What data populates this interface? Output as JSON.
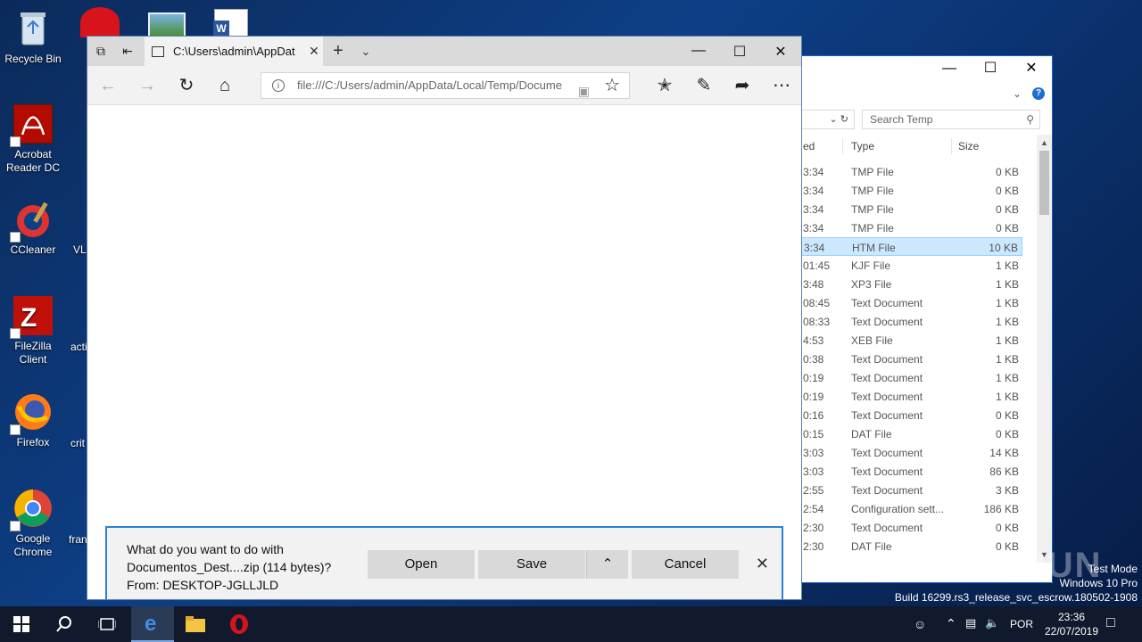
{
  "desktop": {
    "icons": [
      {
        "label": "Recycle Bin",
        "icon": "recycle-bin-icon"
      },
      {
        "label": "Acrobat Reader DC",
        "icon": "acrobat-icon"
      },
      {
        "label": "CCleaner",
        "icon": "ccleaner-icon"
      },
      {
        "label": "FileZilla Client",
        "icon": "filezilla-icon"
      },
      {
        "label": "Firefox",
        "icon": "firefox-icon"
      },
      {
        "label": "Google Chrome",
        "icon": "chrome-icon"
      }
    ],
    "partial_labels": [
      "VL",
      "acti",
      "crit",
      "fran"
    ]
  },
  "edge": {
    "tab_title": "C:\\Users\\admin\\AppDat",
    "url": "file:///C:/Users/admin/AppData/Local/Temp/Docume",
    "download": {
      "line1": "What do you want to do with",
      "line2": "Documentos_Dest....zip (114 bytes)?",
      "line3": "From: DESKTOP-JGLLJLD",
      "open": "Open",
      "save": "Save",
      "cancel": "Cancel"
    }
  },
  "explorer": {
    "search_placeholder": "Search Temp",
    "col_modified": "ed",
    "col_type": "Type",
    "col_size": "Size",
    "rows": [
      {
        "time": "3:34",
        "type": "TMP File",
        "size": "0 KB"
      },
      {
        "time": "3:34",
        "type": "TMP File",
        "size": "0 KB"
      },
      {
        "time": "3:34",
        "type": "TMP File",
        "size": "0 KB"
      },
      {
        "time": "3:34",
        "type": "TMP File",
        "size": "0 KB"
      },
      {
        "time": "3:34",
        "type": "HTM File",
        "size": "10 KB",
        "selected": true
      },
      {
        "time": "01:45",
        "type": "KJF File",
        "size": "1 KB"
      },
      {
        "time": "3:48",
        "type": "XP3 File",
        "size": "1 KB"
      },
      {
        "time": "08:45",
        "type": "Text Document",
        "size": "1 KB"
      },
      {
        "time": "08:33",
        "type": "Text Document",
        "size": "1 KB"
      },
      {
        "time": "4:53",
        "type": "XEB File",
        "size": "1 KB"
      },
      {
        "time": "0:38",
        "type": "Text Document",
        "size": "1 KB"
      },
      {
        "time": "0:19",
        "type": "Text Document",
        "size": "1 KB"
      },
      {
        "time": "0:19",
        "type": "Text Document",
        "size": "1 KB"
      },
      {
        "time": "0:16",
        "type": "Text Document",
        "size": "0 KB"
      },
      {
        "time": "0:15",
        "type": "DAT File",
        "size": "0 KB"
      },
      {
        "time": "3:03",
        "type": "Text Document",
        "size": "14 KB"
      },
      {
        "time": "3:03",
        "type": "Text Document",
        "size": "86 KB"
      },
      {
        "time": "2:55",
        "type": "Text Document",
        "size": "3 KB"
      },
      {
        "time": "2:54",
        "type": "Configuration sett...",
        "size": "186 KB"
      },
      {
        "time": "2:30",
        "type": "Text Document",
        "size": "0 KB"
      },
      {
        "time": "2:30",
        "type": "DAT File",
        "size": "0 KB"
      }
    ]
  },
  "watermark": {
    "line1": "Test Mode",
    "line2": "Windows 10 Pro",
    "line3": "Build 16299.rs3_release_svc_escrow.180502-1908",
    "brand": "ANY RUN"
  },
  "taskbar": {
    "lang": "POR",
    "time": "23:36",
    "date": "22/07/2019"
  }
}
